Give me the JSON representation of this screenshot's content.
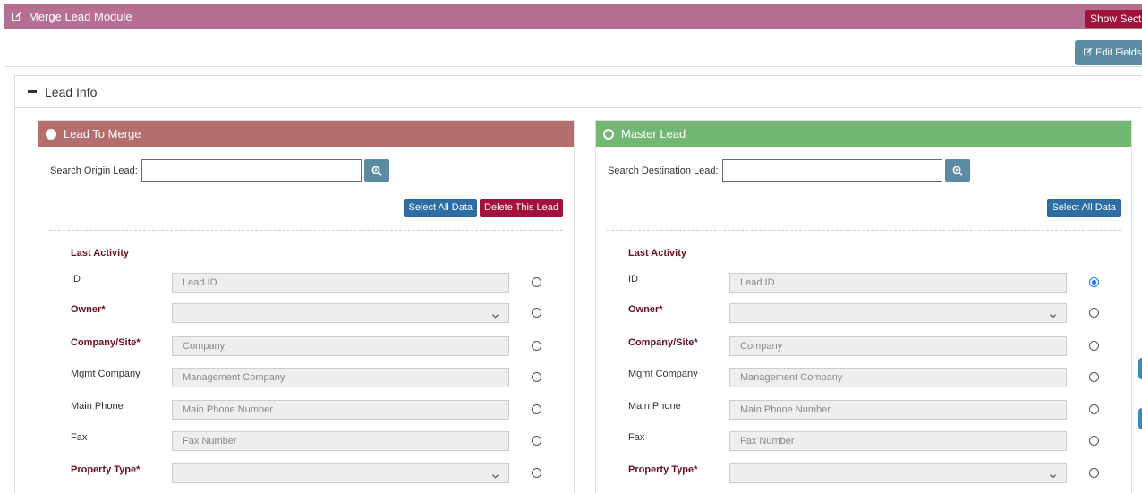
{
  "header": {
    "title": "Merge Lead Module",
    "show_section_label": "Show Section",
    "edit_fields_label": "Edit Fields"
  },
  "lead_info": {
    "label": "Lead Info"
  },
  "left": {
    "title": "Lead To Merge",
    "search_label": "Search Origin Lead:",
    "select_all_label": "Select All Data",
    "delete_label": "Delete This Lead",
    "last_activity": "Last Activity",
    "fields": [
      {
        "label": "ID",
        "placeholder": "Lead ID",
        "required": false,
        "dropdown": false,
        "selected": false
      },
      {
        "label": "Owner*",
        "placeholder": "",
        "required": true,
        "dropdown": true,
        "selected": false
      },
      {
        "label": "Company/Site*",
        "placeholder": "Company",
        "required": true,
        "dropdown": false,
        "selected": false
      },
      {
        "label": "Mgmt Company",
        "placeholder": "Management Company",
        "required": false,
        "dropdown": false,
        "selected": false
      },
      {
        "label": "Main Phone",
        "placeholder": "Main Phone Number",
        "required": false,
        "dropdown": false,
        "selected": false
      },
      {
        "label": "Fax",
        "placeholder": "Fax Number",
        "required": false,
        "dropdown": false,
        "selected": false
      },
      {
        "label": "Property Type*",
        "placeholder": "",
        "required": true,
        "dropdown": true,
        "selected": false
      }
    ]
  },
  "right": {
    "title": "Master Lead",
    "search_label": "Search Destination Lead:",
    "select_all_label": "Select All Data",
    "last_activity": "Last Activity",
    "fields": [
      {
        "label": "ID",
        "placeholder": "Lead ID",
        "required": false,
        "dropdown": false,
        "selected": true
      },
      {
        "label": "Owner*",
        "placeholder": "",
        "required": true,
        "dropdown": true,
        "selected": false
      },
      {
        "label": "Company/Site*",
        "placeholder": "Company",
        "required": true,
        "dropdown": false,
        "selected": false
      },
      {
        "label": "Mgmt Company",
        "placeholder": "Management Company",
        "required": false,
        "dropdown": false,
        "selected": false
      },
      {
        "label": "Main Phone",
        "placeholder": "Main Phone Number",
        "required": false,
        "dropdown": false,
        "selected": false
      },
      {
        "label": "Fax",
        "placeholder": "Fax Number",
        "required": false,
        "dropdown": false,
        "selected": false
      },
      {
        "label": "Property Type*",
        "placeholder": "",
        "required": true,
        "dropdown": true,
        "selected": false
      }
    ]
  }
}
